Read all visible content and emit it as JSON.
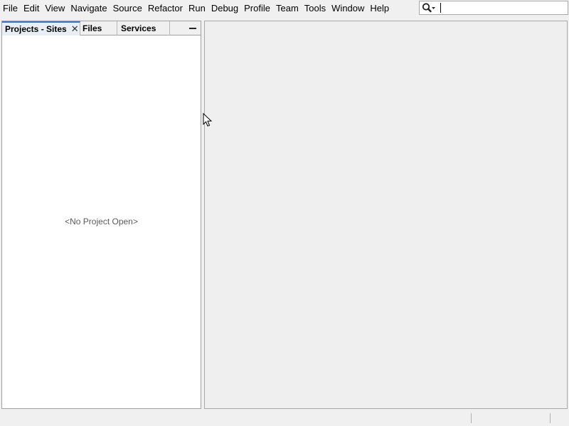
{
  "menubar": {
    "items": [
      {
        "label": "File"
      },
      {
        "label": "Edit"
      },
      {
        "label": "View"
      },
      {
        "label": "Navigate"
      },
      {
        "label": "Source"
      },
      {
        "label": "Refactor"
      },
      {
        "label": "Run"
      },
      {
        "label": "Debug"
      },
      {
        "label": "Profile"
      },
      {
        "label": "Team"
      },
      {
        "label": "Tools"
      },
      {
        "label": "Window"
      },
      {
        "label": "Help"
      }
    ]
  },
  "search": {
    "icon": "magnifier-dropdown-icon",
    "value": "",
    "placeholder": ""
  },
  "projects_panel": {
    "tabs": [
      {
        "label": "Projects - Sites",
        "active": true,
        "closable": true
      },
      {
        "label": "Files",
        "active": false
      },
      {
        "label": "Services",
        "active": false
      }
    ],
    "empty_message": "<No Project Open>"
  },
  "colors": {
    "background": "#f0f0f0",
    "panel_background": "#ffffff",
    "active_tab_accent": "#3c78c8",
    "editor_background": "#efefef"
  }
}
